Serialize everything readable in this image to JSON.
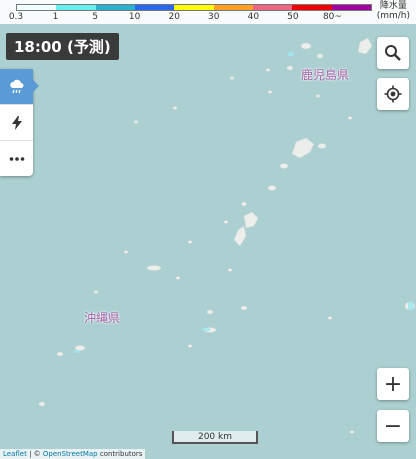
{
  "legend": {
    "colors": [
      "#f0ffff",
      "#66f0f0",
      "#28b2d0",
      "#2868f0",
      "#ffff00",
      "#ffa020",
      "#f06680",
      "#f00000",
      "#a000a0"
    ],
    "ticks": [
      "0.3",
      "1",
      "5",
      "10",
      "20",
      "30",
      "40",
      "50",
      "80~"
    ],
    "unit_line1": "降水量",
    "unit_line2": "(mm/h)"
  },
  "time_label": "18:00 (予測)",
  "side_menu": [
    {
      "icon": "rain-cloud-icon",
      "active": true
    },
    {
      "icon": "lightning-icon",
      "active": false
    },
    {
      "icon": "more-icon",
      "active": false
    }
  ],
  "map_labels": {
    "kagoshima": "鹿児島県",
    "okinawa": "沖縄県"
  },
  "controls": {
    "search_icon": "search-icon",
    "locate_icon": "locate-icon",
    "zoom_in": "+",
    "zoom_out": "−"
  },
  "scale_label": "200 km",
  "attribution": {
    "leaflet": "Leaflet",
    "sep": " | © ",
    "osm": "OpenStreetMap",
    "contrib": " contributors"
  },
  "colors": {
    "sea": "#acd0d1",
    "land": "#ebeeea",
    "rain_light": "#9ee6f0",
    "label": "#a262a8"
  }
}
